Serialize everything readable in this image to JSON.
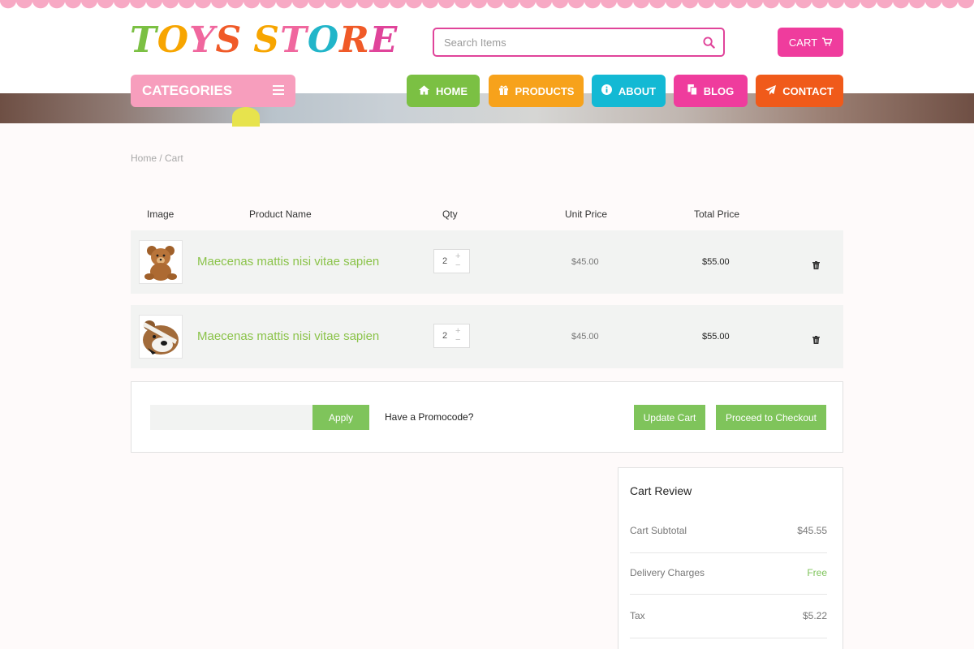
{
  "brand": {
    "letters": [
      "T",
      "O",
      "Y",
      "S",
      " ",
      "S",
      "T",
      "O",
      "R",
      "E"
    ],
    "letter_colors": [
      "#7bc043",
      "#f7a500",
      "#f0679e",
      "#f05a28",
      "#ffffff",
      "#f7a500",
      "#f0679e",
      "#21b5c9",
      "#f05a28",
      "#e0449a"
    ]
  },
  "search": {
    "placeholder": "Search Items",
    "icon": "search-icon"
  },
  "cart_button": {
    "label": "CART",
    "icon": "cart-icon"
  },
  "categories": {
    "label": "CATEGORIES",
    "icon": "hamburger-icon"
  },
  "nav": [
    {
      "label": "HOME",
      "icon": "home-icon",
      "color": "#7bc043"
    },
    {
      "label": "PRODUCTS",
      "icon": "gift-icon",
      "color": "#f7a21b"
    },
    {
      "label": "ABOUT",
      "icon": "info-icon",
      "color": "#13b9d4"
    },
    {
      "label": "BLOG",
      "icon": "copy-icon",
      "color": "#ef3c9d"
    },
    {
      "label": "CONTACT",
      "icon": "paper-plane-icon",
      "color": "#f05a1a"
    }
  ],
  "breadcrumb": "Home / Cart",
  "table": {
    "headers": [
      "Image",
      "Product Name",
      "Qty",
      "Unit Price",
      "Total Price"
    ],
    "rows": [
      {
        "name": "Maecenas mattis nisi vitae sapien",
        "qty": "2",
        "unit_price": "$45.00",
        "total_price": "$55.00"
      },
      {
        "name": "Maecenas mattis nisi vitae sapien",
        "qty": "2",
        "unit_price": "$45.00",
        "total_price": "$55.00"
      }
    ]
  },
  "promo": {
    "input_value": "",
    "apply_label": "Apply",
    "prompt": "Have a Promocode?",
    "update_label": "Update Cart",
    "checkout_label": "Proceed to Checkout"
  },
  "review": {
    "title": "Cart Review",
    "items": [
      {
        "label": "Cart Subtotal",
        "value": "$45.55"
      },
      {
        "label": "Delivery Charges",
        "value": "Free",
        "value_color": "#7fc45b"
      },
      {
        "label": "Tax",
        "value": "$5.22"
      }
    ]
  },
  "colors": {
    "accent_pink": "#ef3c9d",
    "green": "#7fc45b",
    "product_green": "#8bc34a",
    "scallop": "#f7a9c4"
  }
}
